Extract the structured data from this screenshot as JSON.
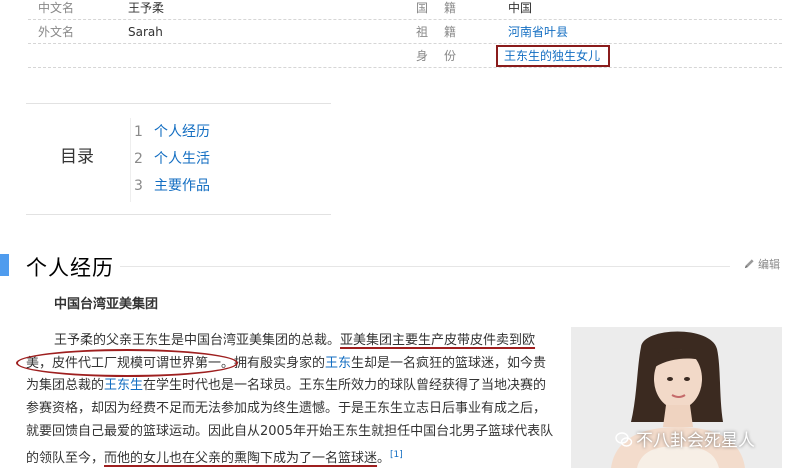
{
  "info": {
    "row1": {
      "k1": "中文名",
      "v1": "王予柔",
      "k2": "国籍",
      "v2": "中国"
    },
    "row2": {
      "k1": "外文名",
      "v1": "Sarah",
      "k2": "祖籍",
      "v2": "河南省叶县"
    },
    "row3": {
      "k2": "身份",
      "v2": "王东生的独生女儿"
    }
  },
  "toc": {
    "title": "目录",
    "items": [
      {
        "num": "1",
        "label": "个人经历"
      },
      {
        "num": "2",
        "label": "个人生活"
      },
      {
        "num": "3",
        "label": "主要作品"
      }
    ]
  },
  "section": {
    "title": "个人经历",
    "edit_label": "编辑",
    "subtitle": "中国台湾亚美集团"
  },
  "paragraph": {
    "l1a": "王予柔的父亲王东生是中国台湾亚美集团的总裁。",
    "l1b": "亚美集团主要生产皮带皮件卖到欧",
    "l2a": "美，皮件代工厂规模可谓世界第一",
    "l2b": "。拥有殷实身家的",
    "l2c": "王东",
    "l2d": "生却是一名疯狂的篮球迷，如今贵",
    "l3a": "为集团总裁的",
    "l3b": "王东生",
    "l3c": "在学生时代也是一名球员。王东生所效力的球队曾经获得了当地决赛的",
    "l4": "参赛资格，却因为经费不足而无法参加成为终生遗憾。于是王东生立志日后事业有成之后，",
    "l5": "就要回馈自己最爱的篮球运动。因此自从2005年开始王东生就担任中国台北男子篮球代表队",
    "l6a": "的领队至今，",
    "l6b": "而他的女儿也在父亲的熏陶下成为了一名篮球迷",
    "l6c": "。",
    "ref": "[1]"
  },
  "watermark": "不八卦会死星人",
  "colors": {
    "link": "#136ec2",
    "annotation": "#9e1f1f",
    "section_accent": "#4f9cee"
  },
  "icons": {
    "edit": "pencil-icon",
    "watermark": "wechat-icon"
  }
}
